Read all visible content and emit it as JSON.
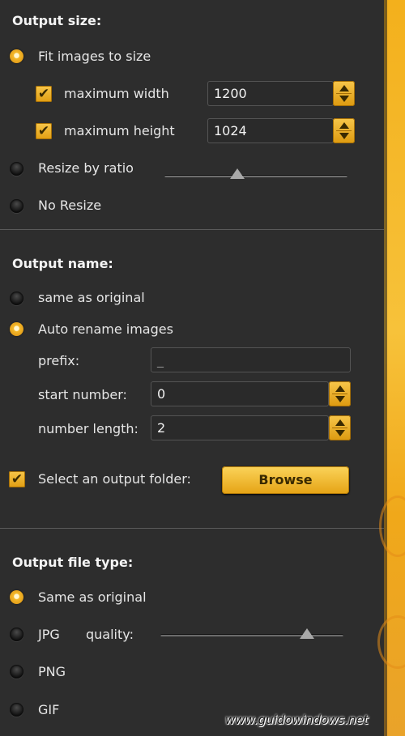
{
  "output_size": {
    "heading": "Output size:",
    "fit_label": "Fit images to size",
    "max_width_label": "maximum width",
    "max_width_value": "1200",
    "max_height_label": "maximum height",
    "max_height_value": "1024",
    "ratio_label": "Resize by ratio",
    "ratio_level": 0.4,
    "no_resize_label": "No Resize"
  },
  "output_name": {
    "heading": "Output name:",
    "same_label": "same as original",
    "auto_label": "Auto rename images",
    "prefix_label": "prefix:",
    "prefix_value": "_",
    "start_label": "start number:",
    "start_value": "0",
    "length_label": "number length:",
    "length_value": "2",
    "folder_label": "Select an output folder:",
    "browse_label": "Browse"
  },
  "output_type": {
    "heading": "Output file type:",
    "same_label": "Same as original",
    "jpg_label": "JPG",
    "quality_label": "quality:",
    "quality_level": 0.8,
    "png_label": "PNG",
    "gif_label": "GIF"
  },
  "watermark": "www.guidowindows.net",
  "colors": {
    "accent": "#f4b82a",
    "panel": "#2d2d2d"
  }
}
